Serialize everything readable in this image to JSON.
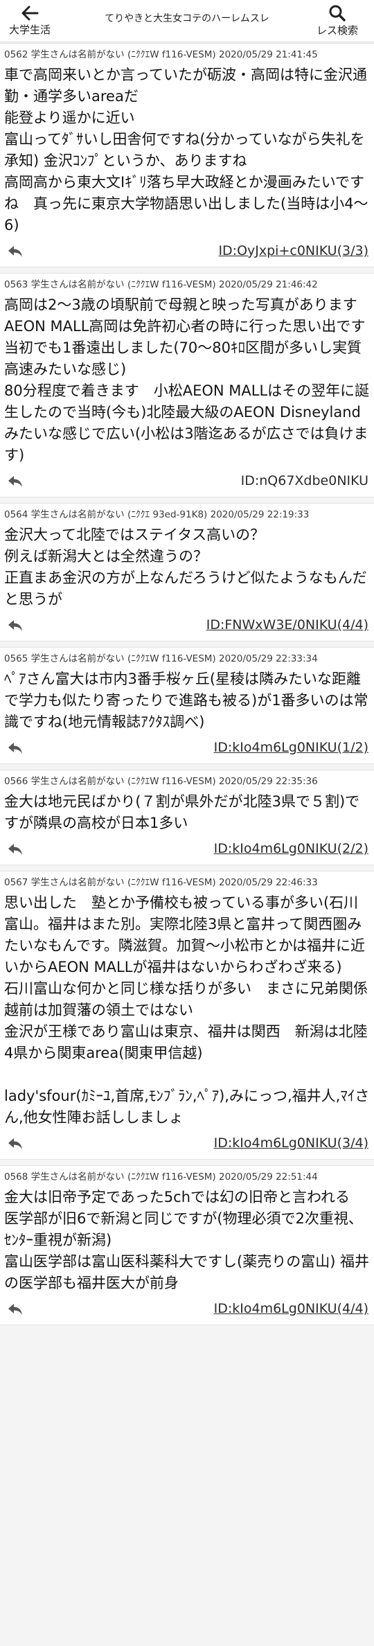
{
  "header": {
    "title": "てりやきと大生女コテのハーレムスレ",
    "back_label": "大学生活",
    "search_label": "レス検索"
  },
  "posts": [
    {
      "meta": "0562 学生さんは名前がない (ﾆｸｸｴW f116-VESM) 2020/05/29 21:41:45",
      "body": "車で高岡来いとか言っていたが砺波・高岡は特に金沢通勤・通学多いareaだ\n能登より遥かに近い\n富山ってﾀﾞｻいし田舎何ですね(分かっていながら失礼を承知) 金沢ｺﾝﾌﾟというか、ありますね\n高岡高から東大文Iｷﾞﾘ落ち早大政経とか漫画みたいですね　真っ先に東京大学物語思い出しました(当時は小4〜6)",
      "id": "ID:OyJxpi+c0NIKU(3/3)"
    },
    {
      "meta": "0563 学生さんは名前がない (ﾆｸｸｴW f116-VESM) 2020/05/29 21:46:42",
      "body": "高岡は2〜3歳の頃駅前で母親と映った写真があります\nAEON MALL高岡は免許初心者の時に行った思い出です　当初でも1番遠出しました(70〜80ｷﾛ区間が多いし実質高速みたいな感じ)\n80分程度で着きます　小松AEON MALLはその翌年に誕生したので当時(今も)北陸最大級のAEON Disneylandみたいな感じで広い(小松は3階迄あるが広さでは負けます)",
      "id": "ID:nQ67Xdbe0NIKU"
    },
    {
      "meta": "0564 学生さんは名前がない (ﾆｸｸｴ 93ed-91K8) 2020/05/29 22:19:33",
      "body": "金沢大って北陸ではステイタス高いの？\n例えば新潟大とは全然違うの？\n正直まあ金沢の方が上なんだろうけど似たようなもんだと思うが",
      "id": "ID:FNWxW3E/0NIKU(4/4)"
    },
    {
      "meta": "0565 学生さんは名前がない (ﾆｸｸｴW f116-VESM) 2020/05/29 22:33:34",
      "body": "ﾍﾟｱさん富大は市内3番手桜ヶ丘(星稜は隣みたいな距離で学力も似たり寄ったりで進路も被る)が1番多いのは常識ですね(地元情報誌ｱｸﾀｽ調べ)",
      "id": "ID:kIo4m6Lg0NIKU(1/2)"
    },
    {
      "meta": "0566 学生さんは名前がない (ﾆｸｸｴW f116-VESM) 2020/05/29 22:35:36",
      "body": "金大は地元民ばかり(７割が県外だが北陸3県で５割)ですが隣県の高校が日本1多い",
      "id": "ID:kIo4m6Lg0NIKU(2/2)"
    },
    {
      "meta": "0567 学生さんは名前がない (ﾆｸｸｴW f116-VESM) 2020/05/29 22:46:33",
      "body": "思い出した　塾とか予備校も被っている事が多い(石川富山。福井はまた別。実際北陸3県と富井って関西圏みたいなもんです。隣滋賀。加賀〜小松市とかは福井に近いからAEON MALLが福井はないからわざわざ来る)\n石川富山な何かと同じ様な括りが多い　まさに兄弟関係　越前は加賀藩の領土ではない\n金沢が王様であり富山は東京、福井は関西　新潟は北陸4県から関東area(関東甲信越)\n\nlady'sfour(ｶﾐｰﾕ,首席,ﾓﾝﾌﾞﾗﾝ,ﾍﾟｱ),みにっつ,福井人,ﾏｲさん,他女性陣お話ししましょ",
      "id": "ID:kIo4m6Lg0NIKU(3/4)"
    },
    {
      "meta": "0568 学生さんは名前がない (ﾆｸｸｴW f116-VESM) 2020/05/29 22:51:44",
      "body": "金大は旧帝予定であった5chでは幻の旧帝と言われる\n医学部が旧6で新潟と同じですが(物理必須で2次重視、ｾﾝﾀｰ重視が新潟)\n富山医学部は富山医科薬科大ですし(薬売りの富山) 福井の医学部も福井医大が前身",
      "id": "ID:kIo4m6Lg0NIKU(4/4)"
    }
  ]
}
